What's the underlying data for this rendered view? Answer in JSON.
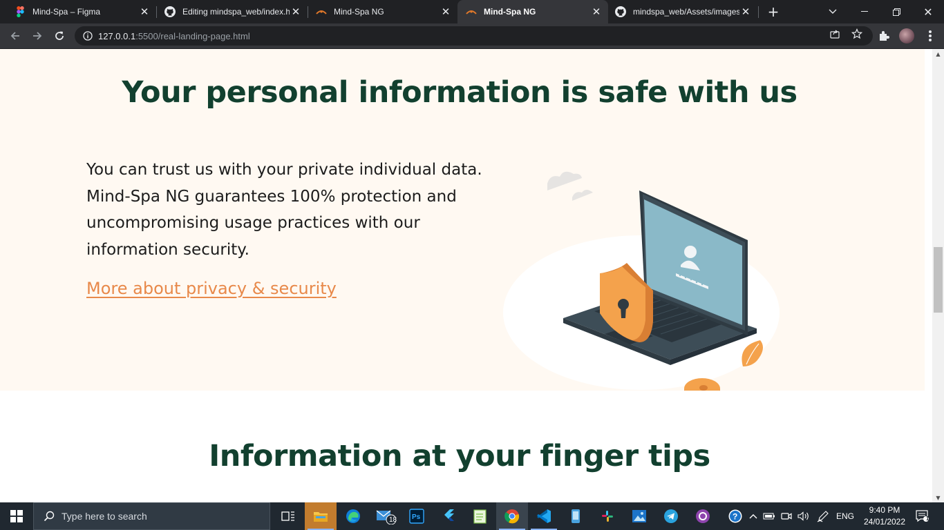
{
  "browser": {
    "tabs": [
      {
        "title": "Mind-Spa – Figma",
        "icon": "figma-icon"
      },
      {
        "title": "Editing mindspa_web/index.h",
        "icon": "github-icon"
      },
      {
        "title": "Mind-Spa NG",
        "icon": "mindspa-icon"
      },
      {
        "title": "Mind-Spa NG",
        "icon": "mindspa-icon",
        "active": true
      },
      {
        "title": "mindspa_web/Assets/images",
        "icon": "github-icon"
      }
    ],
    "url_host": "127.0.0.1",
    "url_rest": ":5500/real-landing-page.html"
  },
  "page": {
    "safe_section": {
      "title": "Your personal information is safe with us",
      "body": "You can trust us with your private individual data. Mind-Spa NG guarantees 100% protection and uncompromising usage practices with our information security.",
      "link": "More about privacy & security"
    },
    "tips_section": {
      "title": "Information at your finger tips"
    }
  },
  "taskbar": {
    "search_placeholder": "Type here to search",
    "mail_badge": "18",
    "language": "ENG",
    "time": "9:40 PM",
    "date": "24/01/2022",
    "notification_count": "1"
  },
  "colors": {
    "heading": "#12402f",
    "link": "#e8894a",
    "section_bg": "#fff9f2",
    "accent_orange": "#f4a24c"
  }
}
